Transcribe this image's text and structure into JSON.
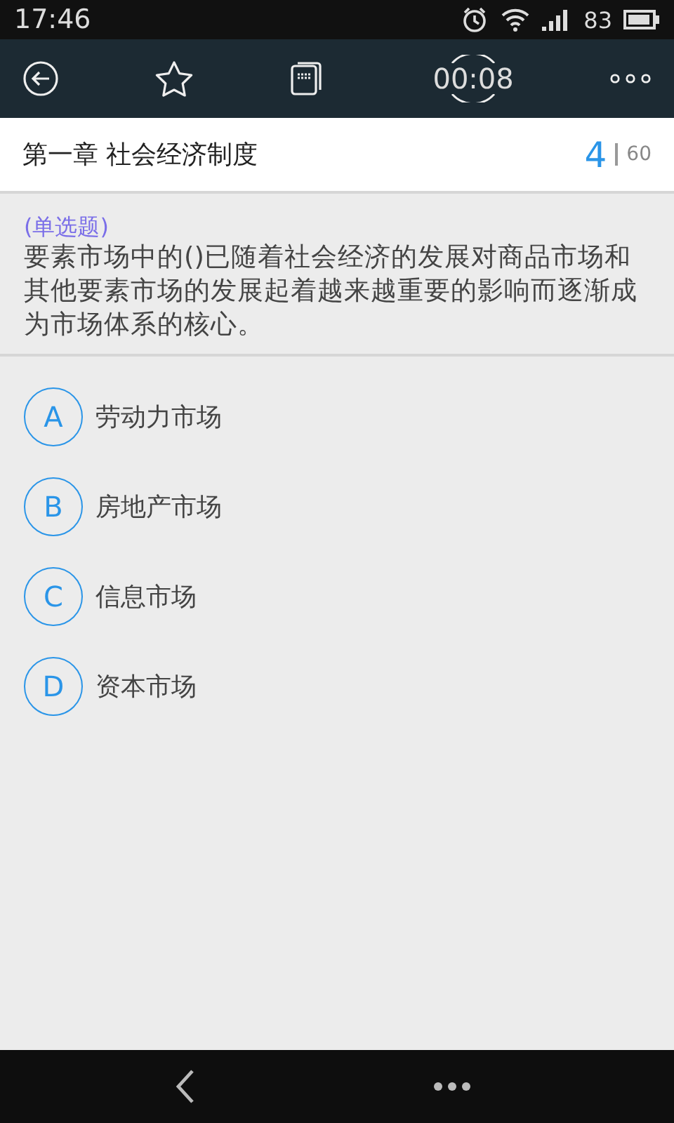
{
  "status_bar": {
    "time": "17:46",
    "battery": "83"
  },
  "toolbar": {
    "timer": "00:08"
  },
  "header": {
    "chapter": "第一章 社会经济制度",
    "current": "4",
    "total": "60"
  },
  "question": {
    "type": "(单选题)",
    "text": "要素市场中的()已随着社会经济的发展对商品市场和其他要素市场的发展起着越来越重要的影响而逐渐成为市场体系的核心。"
  },
  "options": [
    {
      "letter": "A",
      "text": "劳动力市场"
    },
    {
      "letter": "B",
      "text": "房地产市场"
    },
    {
      "letter": "C",
      "text": "信息市场"
    },
    {
      "letter": "D",
      "text": "资本市场"
    }
  ]
}
